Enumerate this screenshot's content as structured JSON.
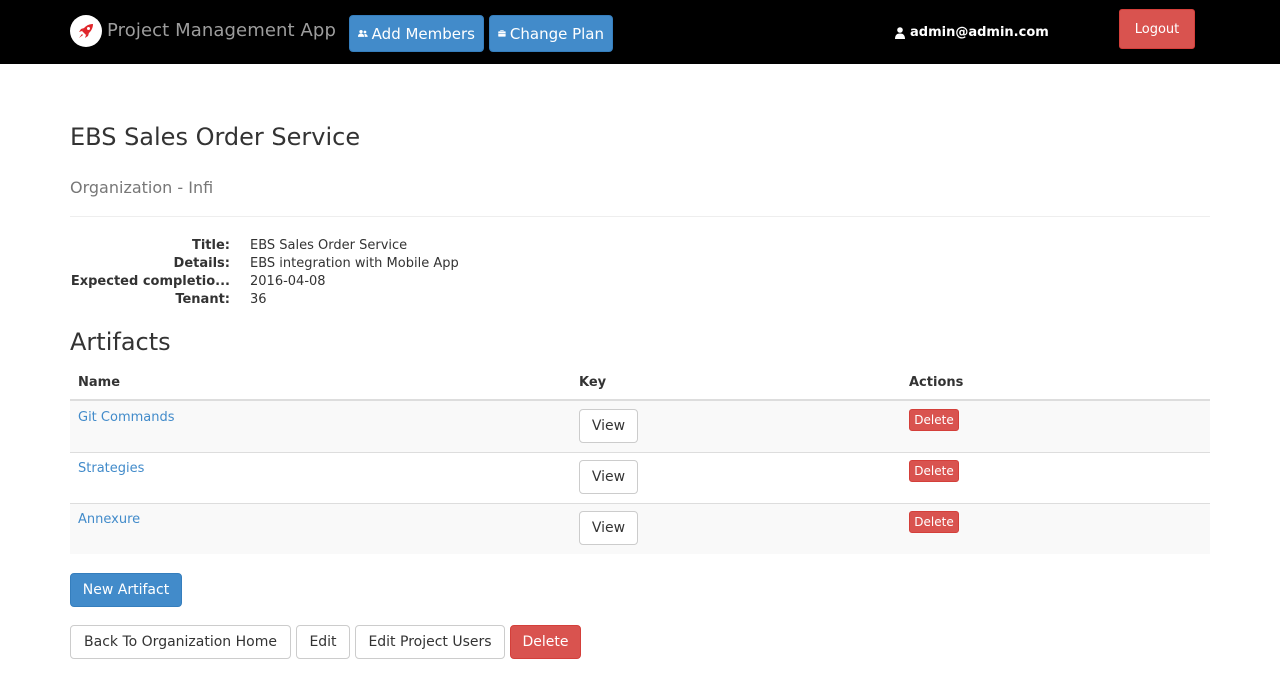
{
  "navbar": {
    "brand": "Project Management App",
    "add_members_label": "Add Members",
    "change_plan_label": "Change Plan",
    "user_email": "admin@admin.com",
    "logout_label": "Logout"
  },
  "project": {
    "title": "EBS Sales Order Service",
    "subtitle": "Organization - Infi",
    "details": [
      {
        "term": "Title:",
        "value": "EBS Sales Order Service"
      },
      {
        "term": "Details:",
        "value": "EBS integration with Mobile App"
      },
      {
        "term": "Expected completio...",
        "value": "2016-04-08"
      },
      {
        "term": "Tenant:",
        "value": "36"
      }
    ]
  },
  "artifacts": {
    "heading": "Artifacts",
    "columns": [
      "Name",
      "Key",
      "Actions"
    ],
    "rows": [
      {
        "name": "Git Commands",
        "key_label": "View",
        "action_label": "Delete"
      },
      {
        "name": "Strategies",
        "key_label": "View",
        "action_label": "Delete"
      },
      {
        "name": "Annexure",
        "key_label": "View",
        "action_label": "Delete"
      }
    ]
  },
  "actions": {
    "new_artifact_label": "New Artifact",
    "back_label": "Back To Organization Home",
    "edit_label": "Edit",
    "edit_users_label": "Edit Project Users",
    "delete_label": "Delete"
  },
  "colors": {
    "primary": "#428bca",
    "danger": "#d9534f",
    "navbar_bg": "#000000",
    "logo_rocket": "#e0262b"
  }
}
